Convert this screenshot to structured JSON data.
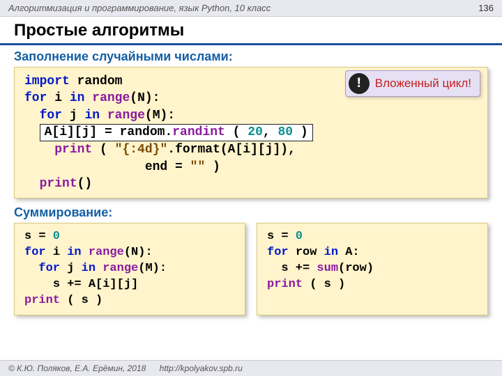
{
  "header": {
    "course": "Алгоритмизация и программирование, язык Python, 10 класс",
    "page_num": "136"
  },
  "title": "Простые алгоритмы",
  "section1_label": "Заполнение случайными числами:",
  "code1": {
    "l1_import": "import",
    "l1_random": "random",
    "l2_for": "for",
    "l2_i": "i",
    "l2_in": "in",
    "l2_range": "range",
    "l2_tail": "(N):",
    "l3_for": "for",
    "l3_j": "j",
    "l3_in": "in",
    "l3_range": "range",
    "l3_tail": "(M):",
    "hl_a": "A[i][j] = random.",
    "hl_randint": "randint",
    "hl_open": " (",
    "hl_20": " 20",
    "hl_comma": ",",
    "hl_80": " 80 ",
    "hl_close": ")",
    "l5_print": "print",
    "l5_open": " (",
    "l5_str": " \"{:4d}\"",
    "l5_after": ".format(A[i][j]),",
    "l6_end": "end =",
    "l6_q": " \"\"",
    "l6_close": " )",
    "l7_print": "print",
    "l7_tail": "()"
  },
  "callout": {
    "badge": "!",
    "text": "Вложенный цикл!"
  },
  "section2_label": "Суммирование:",
  "code2": {
    "l1_s": "s =",
    "l1_zero": " 0",
    "l2_for": "for",
    "l2_i": "i",
    "l2_in": "in",
    "l2_range": "range",
    "l2_tail": "(N):",
    "l3_for": "for",
    "l3_j": "j",
    "l3_in": "in",
    "l3_range": "range",
    "l3_tail": "(M):",
    "l4": "s += A[i][j]",
    "l5_print": "print",
    "l5_tail": " ( s )"
  },
  "code3": {
    "l1_s": "s =",
    "l1_zero": " 0",
    "l2_for": "for",
    "l2_row": "row",
    "l2_in": "in",
    "l2_tail": "A:",
    "l3_s": "s +=",
    "l3_sum": " sum",
    "l3_tail": "(row)",
    "l4_print": "print",
    "l4_tail": " ( s )"
  },
  "footer": {
    "copy": "© К.Ю. Поляков, Е.А. Ерёмин, 2018",
    "url": "http://kpolyakov.spb.ru"
  }
}
